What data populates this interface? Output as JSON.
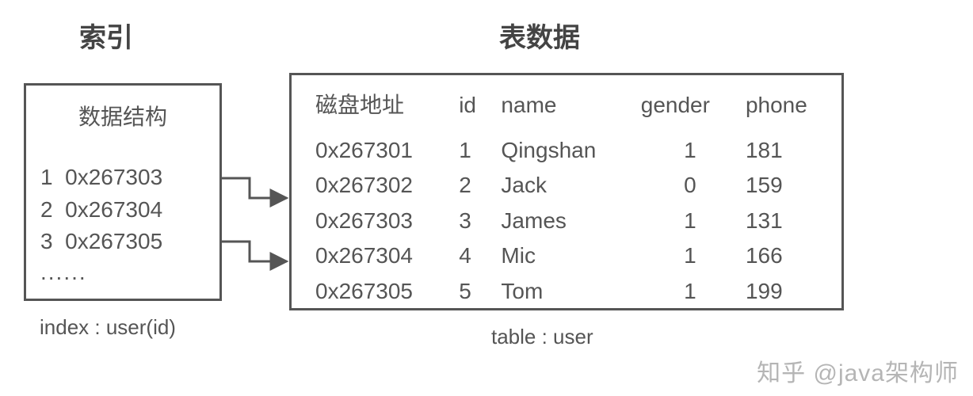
{
  "titles": {
    "index": "索引",
    "table": "表数据"
  },
  "index_box": {
    "subheader": "数据结构",
    "rows": [
      {
        "n": "1",
        "addr": "0x267303"
      },
      {
        "n": "2",
        "addr": "0x267304"
      },
      {
        "n": "3",
        "addr": "0x267305"
      }
    ],
    "ellipsis": "......"
  },
  "table_box": {
    "headers": {
      "addr": "磁盘地址",
      "id": "id",
      "name": "name",
      "gender": "gender",
      "phone": "phone"
    },
    "rows": [
      {
        "addr": "0x267301",
        "id": "1",
        "name": "Qingshan",
        "gender": "1",
        "phone": "181"
      },
      {
        "addr": "0x267302",
        "id": "2",
        "name": "Jack",
        "gender": "0",
        "phone": "159"
      },
      {
        "addr": "0x267303",
        "id": "3",
        "name": "James",
        "gender": "1",
        "phone": "131"
      },
      {
        "addr": "0x267304",
        "id": "4",
        "name": "Mic",
        "gender": "1",
        "phone": "166"
      },
      {
        "addr": "0x267305",
        "id": "5",
        "name": "Tom",
        "gender": "1",
        "phone": "199"
      }
    ]
  },
  "captions": {
    "index": "index : user(id)",
    "table": "table : user"
  },
  "watermark": "知乎 @java架构师"
}
